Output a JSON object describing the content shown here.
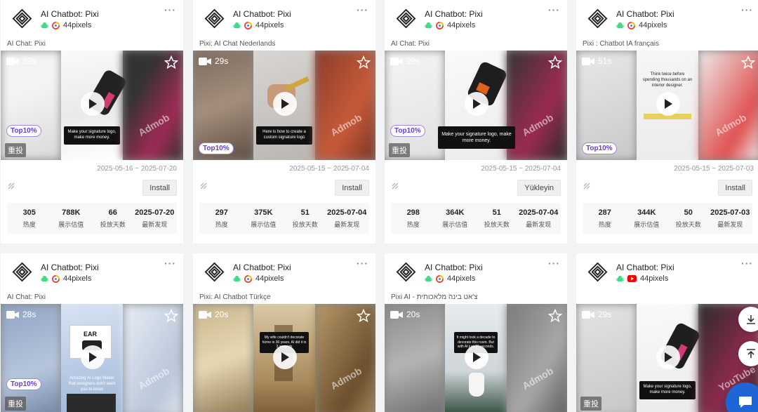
{
  "cards": [
    {
      "app_name": "AI Chatbot: Pixi",
      "developer": "44pixels",
      "subtitle": "AI Chat: Pixi",
      "duration": "29s",
      "top10": "Top10%",
      "retag": "重投",
      "watermark": "Admob",
      "caption": "Make your signature logo, make more money.",
      "dates": "2025-05-16 ~ 2025-07-20",
      "install_label": "Install",
      "stats": [
        {
          "value": "305",
          "label": "热度"
        },
        {
          "value": "788K",
          "label": "展示估值"
        },
        {
          "value": "66",
          "label": "投放天数"
        },
        {
          "value": "2025-07-20",
          "label": "最新发现"
        }
      ]
    },
    {
      "app_name": "AI Chatbot: Pixi",
      "developer": "44pixels",
      "subtitle": "Pixi: AI Chat Nederlands",
      "duration": "29s",
      "top10": "Top10%",
      "watermark": "Admob",
      "caption": "Here is how to create a custom signature logo",
      "dates": "2025-05-15 ~ 2025-07-04",
      "install_label": "Install",
      "stats": [
        {
          "value": "297",
          "label": "热度"
        },
        {
          "value": "375K",
          "label": "展示估值"
        },
        {
          "value": "51",
          "label": "投放天数"
        },
        {
          "value": "2025-07-04",
          "label": "最新发现"
        }
      ]
    },
    {
      "app_name": "AI Chatbot: Pixi",
      "developer": "44pixels",
      "subtitle": "AI Chat: Pixi",
      "duration": "29s",
      "top10": "Top10%",
      "retag": "重投",
      "watermark": "Admob",
      "caption": "Make your signature logo, make more money.",
      "dates": "2025-05-15 ~ 2025-07-04",
      "install_label": "Yükleyin",
      "stats": [
        {
          "value": "298",
          "label": "热度"
        },
        {
          "value": "364K",
          "label": "展示估值"
        },
        {
          "value": "51",
          "label": "投放天数"
        },
        {
          "value": "2025-07-04",
          "label": "最新发现"
        }
      ]
    },
    {
      "app_name": "AI Chatbot: Pixi",
      "developer": "44pixels",
      "subtitle": "Pixi : Chatbot IA français",
      "duration": "51s",
      "top10": "Top10%",
      "watermark": "Admob",
      "caption": "Think twice before spending thousands on an interior designer.",
      "dates": "2025-05-15 ~ 2025-07-03",
      "install_label": "Install",
      "stats": [
        {
          "value": "287",
          "label": "热度"
        },
        {
          "value": "344K",
          "label": "展示估值"
        },
        {
          "value": "50",
          "label": "投放天数"
        },
        {
          "value": "2025-07-03",
          "label": "最新发现"
        }
      ]
    },
    {
      "app_name": "AI Chatbot: Pixi",
      "developer": "44pixels",
      "subtitle": "AI Chat: Pixi",
      "duration": "28s",
      "top10": "Top10%",
      "retag": "重投",
      "watermark": "Admob",
      "caption": "Amazing AI Logo Maker that designers don't want you to know"
    },
    {
      "app_name": "AI Chatbot: Pixi",
      "developer": "44pixels",
      "subtitle": "Pixi: AI Chatbot Türkçe",
      "duration": "20s",
      "watermark": "Admob",
      "caption": "My wife couldn't decorate home in 30 years. AI did it in 3 seconds"
    },
    {
      "app_name": "AI Chatbot: Pixi",
      "developer": "44pixels",
      "subtitle": "Pixi AI - צ'אט בינה מלאכותית",
      "duration": "20s",
      "watermark": "Admob",
      "caption": "It might took a decade to decorate this room. But with AI just 10 seconds."
    },
    {
      "app_name": "AI Chatbot: Pixi",
      "developer": "44pixels",
      "subtitle": "",
      "duration": "29s",
      "retag": "重投",
      "watermark": "YouTube",
      "caption": "Make your signature logo, make more money."
    }
  ],
  "colors": {
    "accent": "#6a3bd6",
    "chat": "#1e66d8"
  }
}
